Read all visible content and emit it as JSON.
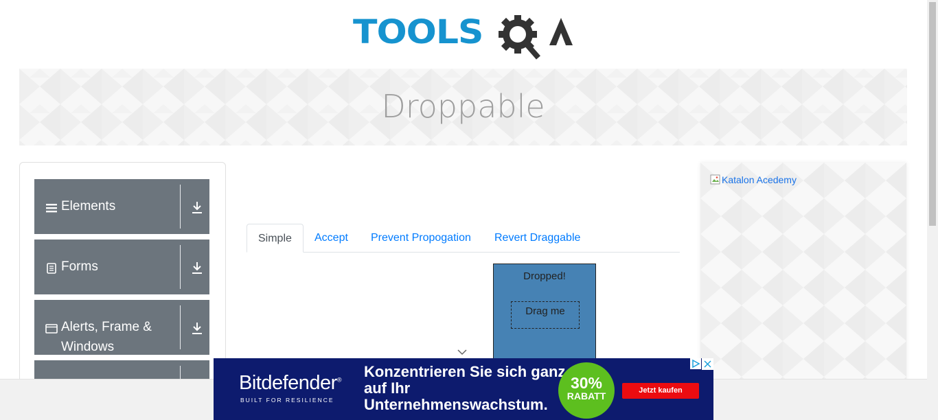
{
  "header": {
    "logo_text": "TOOLS",
    "logo_suffix": "QA"
  },
  "page": {
    "title": "Droppable"
  },
  "sidebar": {
    "groups": [
      {
        "label": "Elements",
        "icon": "hamburger-icon"
      },
      {
        "label": "Forms",
        "icon": "form-icon"
      },
      {
        "label": "Alerts, Frame & Windows",
        "icon": "window-icon"
      },
      {
        "label": "",
        "icon": ""
      }
    ]
  },
  "tabs": [
    {
      "label": "Simple",
      "active": true
    },
    {
      "label": "Accept",
      "active": false
    },
    {
      "label": "Prevent Propogation",
      "active": false
    },
    {
      "label": "Revert Draggable",
      "active": false
    }
  ],
  "droppable": {
    "drop_text": "Dropped!",
    "drag_text": "Drag me",
    "drop_color": "#4682b4"
  },
  "right_ad": {
    "alt_text": "Katalon Acedemy"
  },
  "bottom_ad": {
    "brand": "Bitdefender",
    "brand_mark": "®",
    "tagline": "BUILT FOR RESILIENCE",
    "headline": "Konzentrieren Sie sich ganz auf Ihr Unternehmenswachstum.",
    "badge_percent": "30%",
    "badge_label": "RABATT",
    "cta": "Jetzt kaufen",
    "colors": {
      "background": "#0d1b6e",
      "badge": "#5dbf1f",
      "cta": "#ec0c10"
    }
  },
  "colors": {
    "logo_blue": "#1693cf",
    "sidebar_group": "#6c757d",
    "link": "#007bff"
  }
}
